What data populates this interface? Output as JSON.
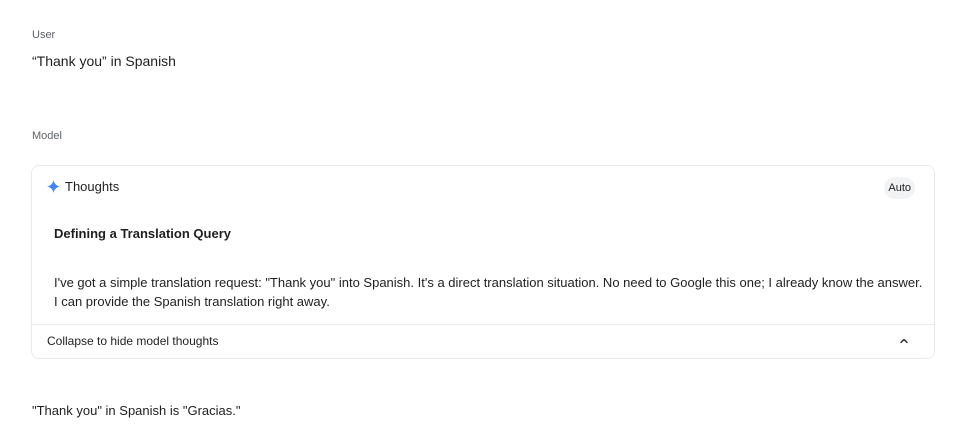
{
  "user": {
    "label": "User",
    "message": "“Thank you” in Spanish"
  },
  "model": {
    "label": "Model",
    "thoughts": {
      "icon": "sparkle-icon",
      "title": "Thoughts",
      "mode_badge": "Auto",
      "heading": "Defining a Translation Query",
      "body": "I've got a simple translation request: \"Thank you\" into Spanish. It's a direct translation situation. No need to Google this one; I already know the answer. I can provide the Spanish translation right away.",
      "collapse_label": "Collapse to hide model thoughts",
      "collapse_icon": "chevron-up-icon"
    },
    "answer": "\"Thank you\" in Spanish is \"Gracias.\""
  },
  "colors": {
    "accent": "#4285f4",
    "muted_text": "#5f6368",
    "border": "#e8eaed",
    "badge_bg": "#f1f3f4"
  }
}
